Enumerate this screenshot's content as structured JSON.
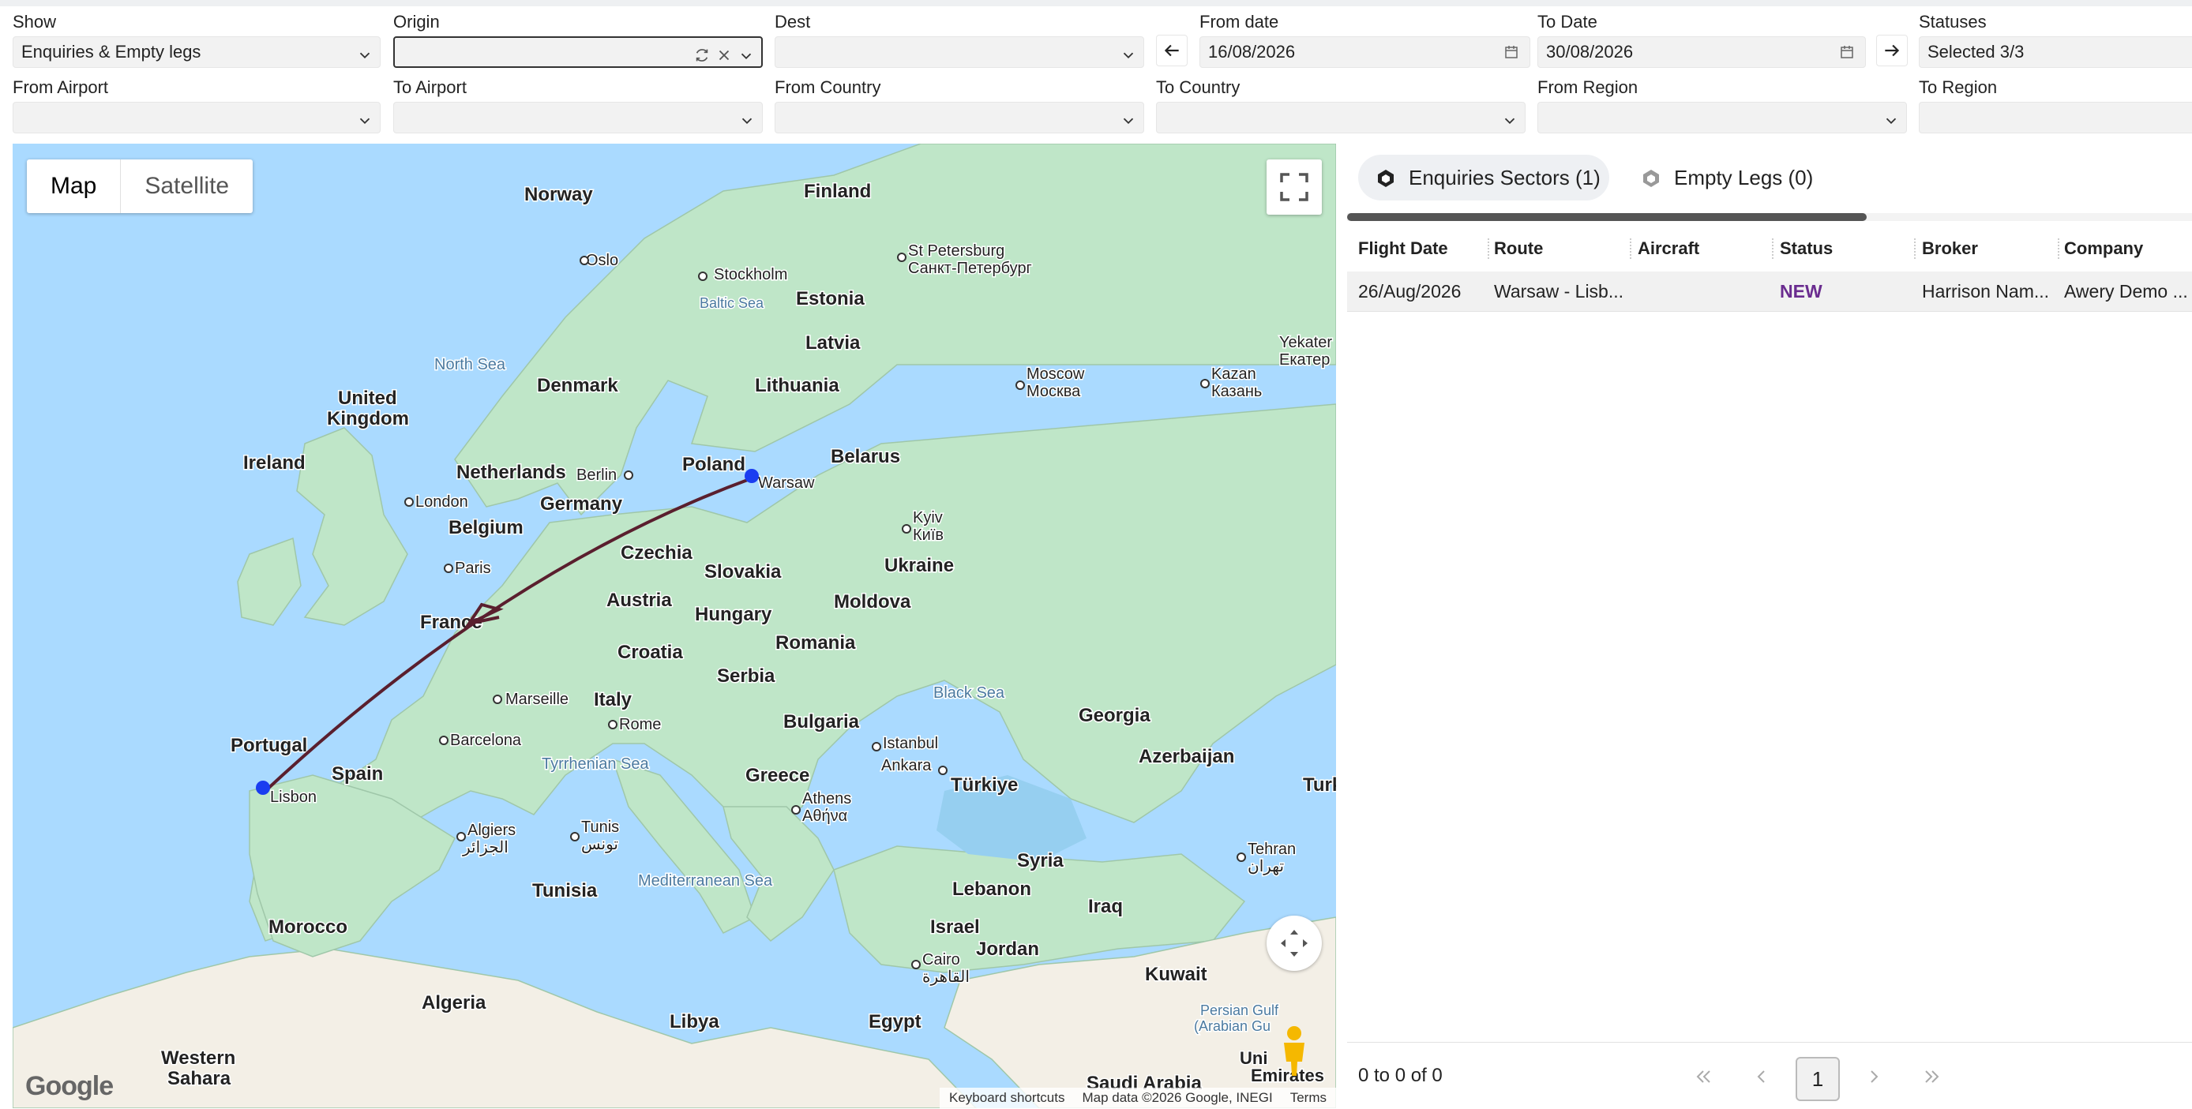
{
  "filters": {
    "show": {
      "label": "Show",
      "value": "Enquiries & Empty legs"
    },
    "origin": {
      "label": "Origin",
      "value": ""
    },
    "dest": {
      "label": "Dest",
      "value": ""
    },
    "from_date": {
      "label": "From date",
      "value": "16/08/2026"
    },
    "to_date": {
      "label": "To Date",
      "value": "30/08/2026"
    },
    "statuses": {
      "label": "Statuses",
      "value": "Selected 3/3"
    },
    "from_airport": {
      "label": "From Airport",
      "value": ""
    },
    "to_airport": {
      "label": "To Airport",
      "value": ""
    },
    "from_country": {
      "label": "From Country",
      "value": ""
    },
    "to_country": {
      "label": "To Country",
      "value": ""
    },
    "from_region": {
      "label": "From Region",
      "value": ""
    },
    "to_region": {
      "label": "To Region",
      "value": ""
    }
  },
  "map": {
    "type_buttons": {
      "map": "Map",
      "satellite": "Satellite"
    },
    "google_logo": "Google",
    "attribution": {
      "shortcuts": "Keyboard shortcuts",
      "data": "Map data ©2026 Google, INEGI",
      "terms": "Terms"
    },
    "labels": {
      "norway": "Norway",
      "finland": "Finland",
      "oslo": "Oslo",
      "stockholm": "Stockholm",
      "st_petersburg": "St Petersburg",
      "st_petersburg_ru": "Санкт-Петербург",
      "baltic_sea": "Baltic Sea",
      "estonia": "Estonia",
      "latvia": "Latvia",
      "lithuania": "Lithuania",
      "north_sea": "North Sea",
      "denmark": "Denmark",
      "united_kingdom_1": "United",
      "united_kingdom_2": "Kingdom",
      "ireland": "Ireland",
      "moscow": "Moscow",
      "moscow_ru": "Москва",
      "kazan": "Kazan",
      "kazan_ru": "Казань",
      "yekaterinburg": "Yekater",
      "yekaterinburg_ru": "Екатер",
      "netherlands": "Netherlands",
      "berlin": "Berlin",
      "poland": "Poland",
      "belarus": "Belarus",
      "warsaw": "Warsaw",
      "london": "London",
      "germany": "Germany",
      "belgium": "Belgium",
      "kyiv": "Kyiv",
      "kyiv_ua": "Київ",
      "paris": "Paris",
      "czechia": "Czechia",
      "slovakia": "Slovakia",
      "ukraine": "Ukraine",
      "austria": "Austria",
      "moldova": "Moldova",
      "hungary": "Hungary",
      "france": "France",
      "romania": "Romania",
      "croatia": "Croatia",
      "serbia": "Serbia",
      "black_sea": "Black Sea",
      "georgia": "Georgia",
      "marseille": "Marseille",
      "italy": "Italy",
      "bulgaria": "Bulgaria",
      "rome": "Rome",
      "istanbul": "Istanbul",
      "barcelona": "Barcelona",
      "portugal": "Portugal",
      "azerbaijan": "Azerbaijan",
      "ankara": "Ankara",
      "tyrrhenian": "Tyrrhenian Sea",
      "greece": "Greece",
      "spain": "Spain",
      "turkiye": "Türkiye",
      "turk_cut": "Turk",
      "lisbon": "Lisbon",
      "athens": "Athens",
      "athens_gr": "Αθήνα",
      "algiers": "Algiers",
      "algiers_ar": "الجزائر",
      "tunis": "Tunis",
      "tunis_ar": "تونس",
      "tehran": "Tehran",
      "tehran_fa": "تهران",
      "syria": "Syria",
      "tunisia": "Tunisia",
      "mediterranean": "Mediterranean Sea",
      "lebanon": "Lebanon",
      "iraq": "Iraq",
      "morocco": "Morocco",
      "israel": "Israel",
      "jordan": "Jordan",
      "cairo": "Cairo",
      "cairo_ar": "القاهرة",
      "kuwait": "Kuwait",
      "algeria": "Algeria",
      "libya": "Libya",
      "egypt": "Egypt",
      "persian_gulf_1": "Persian Gulf",
      "persian_gulf_2": "(Arabian Gu",
      "western_sahara_1": "Western",
      "western_sahara_2": "Sahara",
      "saudi": "Saudi Arabia",
      "uae_1": "Uni",
      "uae_2": "Emirates"
    }
  },
  "tabs": [
    {
      "label": "Enquiries Sectors (1)"
    },
    {
      "label": "Empty Legs (0)"
    }
  ],
  "table": {
    "columns": [
      "Flight Date",
      "Route",
      "Aircraft",
      "Status",
      "Broker",
      "Company"
    ],
    "rows": [
      [
        "26/Aug/2026",
        "Warsaw - Lisb...",
        "",
        "NEW",
        "Harrison Nam...",
        "Awery Demo ..."
      ]
    ]
  },
  "pagination": {
    "info": "0 to 0 of 0",
    "page": "1"
  },
  "colors": {
    "route": "#5a1f2e",
    "marker": "#1a3df0",
    "status_new": "#6a2c8f",
    "water": "#aadaff",
    "land": "#bfe6c8"
  }
}
